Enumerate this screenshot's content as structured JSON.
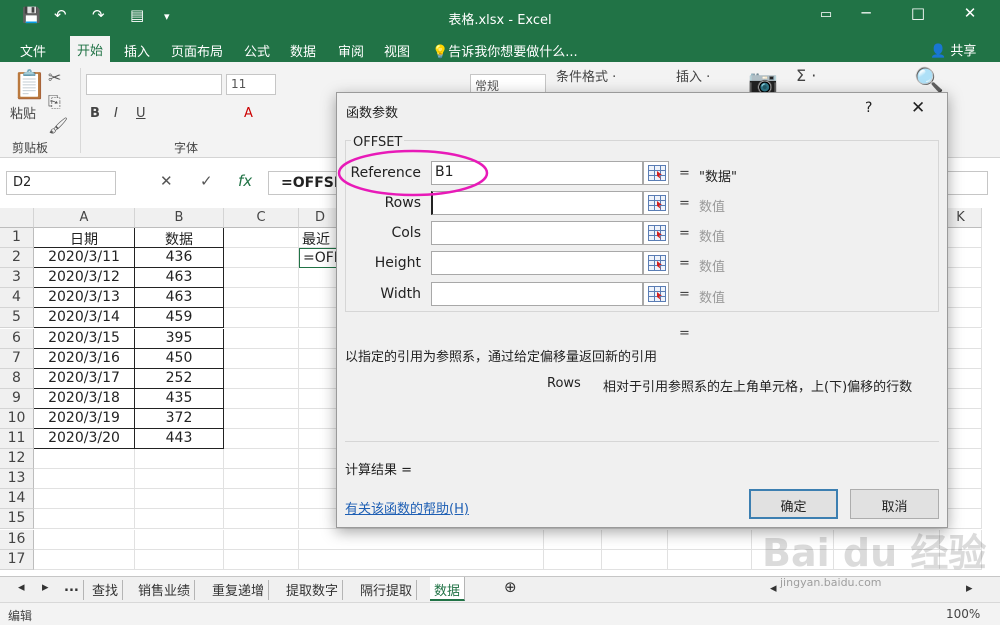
{
  "window": {
    "title": "表格.xlsx - Excel",
    "controls": [
      "─",
      "□",
      "✕"
    ]
  },
  "quick_access": {
    "save": "💾",
    "undo": "↶",
    "redo": "↷",
    "form": "▤",
    "more": "▾"
  },
  "ribbon_tabs": [
    "文件",
    "开始",
    "插入",
    "页面布局",
    "公式",
    "数据",
    "审阅",
    "视图"
  ],
  "active_tab": "开始",
  "tell_me": "告诉我你想要做什么...",
  "share": "共享",
  "ribbon": {
    "paste": "粘贴",
    "clipboard_group": "剪贴板",
    "font_group": "字体",
    "font_size": "11",
    "bold": "B",
    "italic": "I",
    "underline": "U",
    "font_color": "A",
    "number_format": "常规",
    "cond_format": "条件格式 ·",
    "insert": "插入 ·",
    "sum": "Σ ·"
  },
  "formula_bar": {
    "name_box": "D2",
    "cancel": "✕",
    "enter": "✓",
    "fx": "fx",
    "formula": "=OFFSE"
  },
  "grid": {
    "columns": [
      "A",
      "B",
      "C",
      "D",
      "K"
    ],
    "rows": [
      "1",
      "2",
      "3",
      "4",
      "5",
      "6",
      "7",
      "8",
      "9",
      "10",
      "11",
      "12",
      "13",
      "14",
      "15",
      "16",
      "17"
    ],
    "header_a": "日期",
    "header_b": "数据",
    "dates": [
      "2020/3/11",
      "2020/3/12",
      "2020/3/13",
      "2020/3/14",
      "2020/3/15",
      "2020/3/16",
      "2020/3/17",
      "2020/3/18",
      "2020/3/19",
      "2020/3/20"
    ],
    "values": [
      "436",
      "463",
      "463",
      "459",
      "395",
      "450",
      "252",
      "435",
      "372",
      "443"
    ],
    "d1": "最近",
    "d2": "=OFF"
  },
  "sheet_tabs": [
    "查找",
    "销售业绩",
    "重复递增",
    "提取数字",
    "隔行提取",
    "数据"
  ],
  "active_sheet": "数据",
  "sheet_nav": {
    "prev": "◂",
    "next": "▸",
    "more": "...",
    "add": "⊕"
  },
  "status": {
    "mode": "编辑",
    "zoom": "100%"
  },
  "dialog": {
    "title": "函数参数",
    "help_icon": "?",
    "close_icon": "✕",
    "function_name": "OFFSET",
    "args": [
      {
        "label": "Reference",
        "value": "B1",
        "result": "\"数据\""
      },
      {
        "label": "Rows",
        "value": "",
        "result": "数值"
      },
      {
        "label": "Cols",
        "value": "",
        "result": "数值"
      },
      {
        "label": "Height",
        "value": "",
        "result": "数值"
      },
      {
        "label": "Width",
        "value": "",
        "result": "数值"
      }
    ],
    "equals": "=",
    "description": "以指定的引用为参照系，通过给定偏移量返回新的引用",
    "arg_desc_name": "Rows",
    "arg_desc_text": "相对于引用参照系的左上角单元格，上(下)偏移的行数",
    "result_label": "计算结果 =",
    "help_link": "有关该函数的帮助(H)",
    "ok": "确定",
    "cancel": "取消"
  },
  "watermark": {
    "brand": "Bai du 经验",
    "url": "jingyan.baidu.com"
  },
  "colors": {
    "excel_green": "#217346",
    "annotation": "#e81ab8",
    "link": "#1e5fb4"
  }
}
